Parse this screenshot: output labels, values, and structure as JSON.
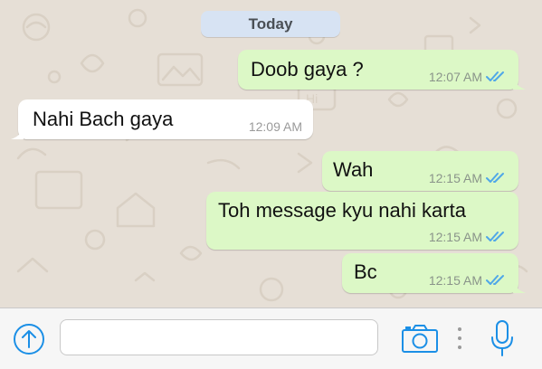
{
  "chat": {
    "date_label": "Today",
    "messages": [
      {
        "direction": "outgoing",
        "text": "Doob gaya ?",
        "time": "12:07 AM",
        "status": "read"
      },
      {
        "direction": "incoming",
        "text": "Nahi Bach gaya",
        "time": "12:09 AM"
      },
      {
        "direction": "outgoing",
        "text": "Wah",
        "time": "12:15 AM",
        "status": "read"
      },
      {
        "direction": "outgoing",
        "text": "Toh message kyu nahi karta",
        "time": "12:15 AM",
        "status": "read"
      },
      {
        "direction": "outgoing",
        "text": "Bc",
        "time": "12:15 AM",
        "status": "read"
      }
    ]
  },
  "composer": {
    "placeholder": "",
    "value": "",
    "icons": [
      "upload-icon",
      "camera-icon",
      "more-dots-icon",
      "microphone-icon"
    ]
  },
  "colors": {
    "outgoing_bubble": "#dcf8c6",
    "incoming_bubble": "#ffffff",
    "read_ticks": "#4fa7e8",
    "accent": "#1b8fe6",
    "wallpaper": "#e6dfd6"
  }
}
